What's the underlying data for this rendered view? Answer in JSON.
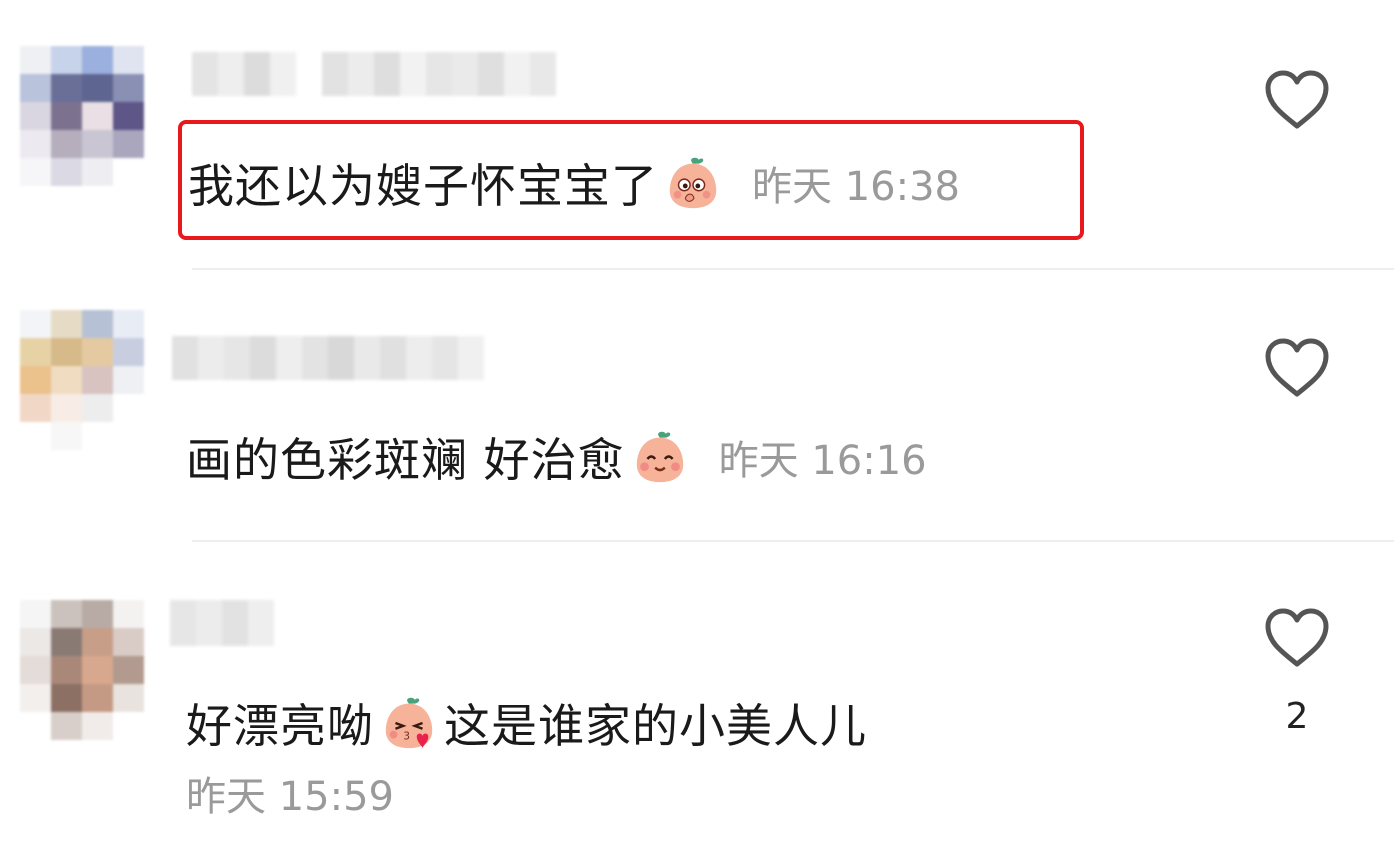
{
  "comments": [
    {
      "text": "我还以为嫂子怀宝宝了",
      "emoji": "peach-shy-emoji",
      "time": "昨天 16:38",
      "highlighted": true,
      "like_count": ""
    },
    {
      "text": "画的色彩斑斓 好治愈",
      "emoji": "peach-smile-emoji",
      "time": "昨天 16:16",
      "highlighted": false,
      "like_count": ""
    },
    {
      "text_before": "好漂亮呦",
      "emoji": "peach-kiss-emoji",
      "text_after": "这是谁家的小美人儿",
      "time": "昨天 15:59",
      "highlighted": false,
      "like_count": "2"
    }
  ],
  "colors": {
    "highlight_border": "#e8191d",
    "time_text": "#9a9a9a",
    "heart_outline": "#555555"
  },
  "icons": [
    "heart-outline-icon",
    "peach-emoji-icon"
  ]
}
